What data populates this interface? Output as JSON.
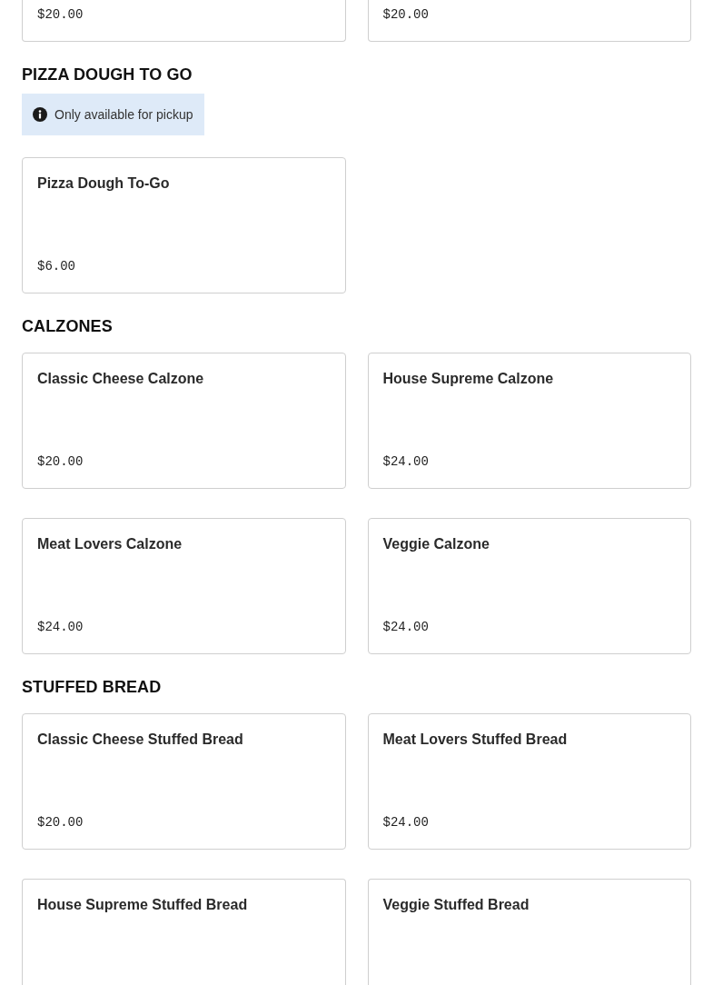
{
  "sections": [
    {
      "items": [
        {
          "price": "$20.00"
        },
        {
          "price": "$20.00"
        }
      ]
    },
    {
      "title": "PIZZA DOUGH TO GO",
      "notice": "Only available for pickup",
      "items": [
        {
          "name": "Pizza Dough To-Go",
          "price": "$6.00"
        }
      ]
    },
    {
      "title": "CALZONES",
      "items": [
        {
          "name": "Classic Cheese Calzone",
          "price": "$20.00"
        },
        {
          "name": "House Supreme Calzone",
          "price": "$24.00"
        },
        {
          "name": "Meat Lovers Calzone",
          "price": "$24.00"
        },
        {
          "name": "Veggie Calzone",
          "price": "$24.00"
        }
      ]
    },
    {
      "title": "STUFFED BREAD",
      "items": [
        {
          "name": "Classic Cheese Stuffed Bread",
          "price": "$20.00"
        },
        {
          "name": "Meat Lovers Stuffed Bread",
          "price": "$24.00"
        },
        {
          "name": "House Supreme Stuffed Bread"
        },
        {
          "name": "Veggie Stuffed Bread"
        }
      ]
    }
  ]
}
